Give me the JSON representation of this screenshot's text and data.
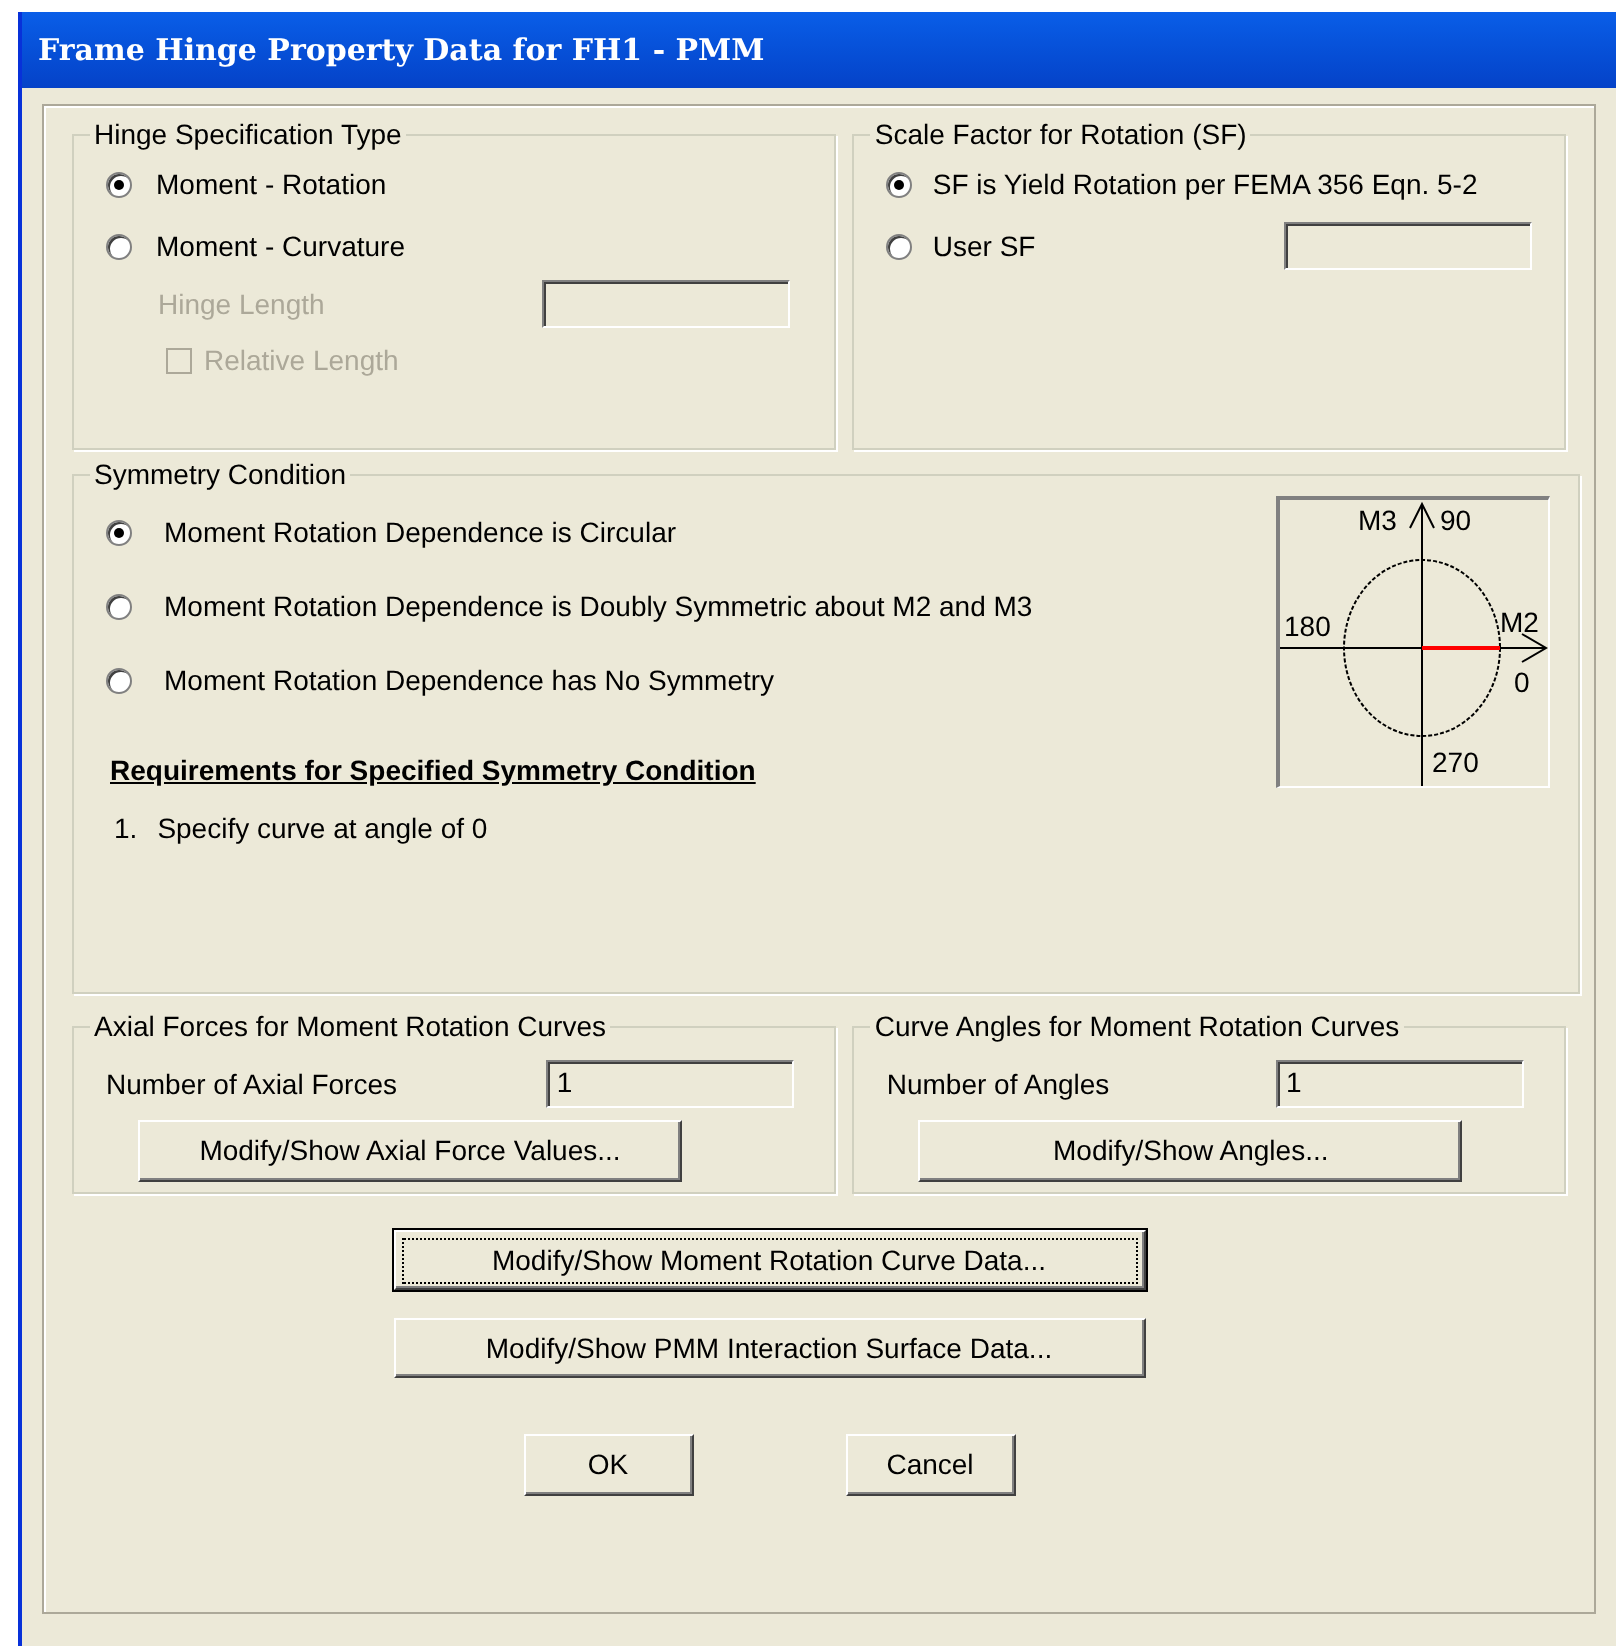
{
  "window": {
    "title": "Frame Hinge Property Data for FH1 - PMM"
  },
  "hinge_spec": {
    "title": "Hinge Specification Type",
    "options": [
      {
        "label": "Moment - Rotation",
        "selected": true
      },
      {
        "label": "Moment - Curvature",
        "selected": false
      }
    ],
    "hinge_length": {
      "label": "Hinge Length",
      "disabled": true
    },
    "relative_length": {
      "label": "Relative Length",
      "checked": false,
      "disabled": true
    }
  },
  "scale_factor": {
    "title": "Scale Factor for Rotation (SF)",
    "options": [
      {
        "label": "SF is Yield Rotation per FEMA 356 Eqn. 5-2",
        "selected": true
      },
      {
        "label": "User SF",
        "selected": false
      }
    ]
  },
  "symmetry": {
    "title": "Symmetry Condition",
    "options": [
      {
        "label": "Moment Rotation Dependence is Circular",
        "selected": true
      },
      {
        "label": "Moment Rotation Dependence is Doubly Symmetric about M2 and M3",
        "selected": false
      },
      {
        "label": "Moment Rotation Dependence has No Symmetry",
        "selected": false
      }
    ],
    "requirements_heading": "Requirements for Specified Symmetry Condition",
    "requirements": [
      {
        "number": "1.",
        "text": "Specify curve at angle of 0"
      }
    ],
    "diagram": {
      "m3": "M3",
      "deg90": "90",
      "deg180": "180",
      "m2": "M2",
      "deg0": "0",
      "deg270": "270"
    }
  },
  "axial": {
    "title": "Axial Forces for Moment Rotation Curves",
    "label": "Number of Axial Forces",
    "value": "1",
    "button": "Modify/Show Axial Force Values..."
  },
  "angles": {
    "title": "Curve Angles for Moment Rotation Curves",
    "label": "Number of Angles",
    "value": "1",
    "button": "Modify/Show Angles..."
  },
  "buttons": [
    {
      "label": "Modify/Show Moment Rotation Curve Data...",
      "focused": true
    },
    {
      "label": "Modify/Show PMM Interaction Surface Data...",
      "focused": false
    }
  ],
  "dialog_buttons": [
    {
      "label": "OK",
      "focused": false
    },
    {
      "label": "Cancel",
      "focused": false
    }
  ]
}
